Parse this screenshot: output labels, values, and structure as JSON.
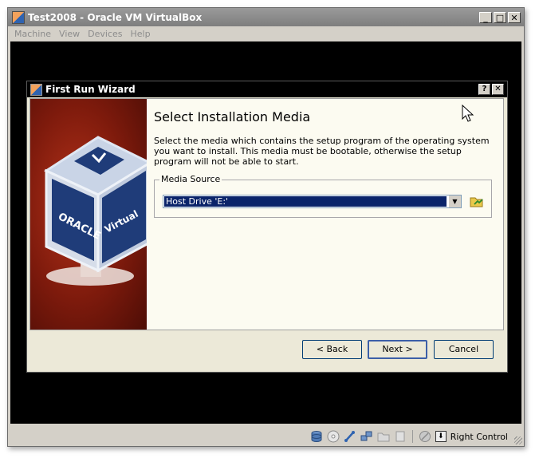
{
  "window": {
    "title": "Test2008 - Oracle VM VirtualBox",
    "minimize": "_",
    "maximize": "□",
    "close": "✕"
  },
  "menu": [
    "Machine",
    "View",
    "Devices",
    "Help"
  ],
  "wizard": {
    "title": "First Run Wizard",
    "help": "?",
    "close": "✕",
    "page_title": "Select Installation Media",
    "description": "Select the media which contains the setup program of the operating system you want to install. This media must be bootable, otherwise the setup program will not be able to start.",
    "media_source_label": "Media Source",
    "media_selected": "Host Drive 'E:'",
    "buttons": {
      "back": "< Back",
      "next": "Next >",
      "cancel": "Cancel"
    },
    "side_image": {
      "oracle": "ORACLE",
      "virtual": "Virtual"
    }
  },
  "statusbar": {
    "host_key": "Right Control",
    "icons": [
      "hard-disk-icon",
      "cd-icon",
      "usb-icon",
      "network-icon",
      "shared-folder-icon",
      "mouse-integration-icon",
      "host-key-icon"
    ]
  }
}
